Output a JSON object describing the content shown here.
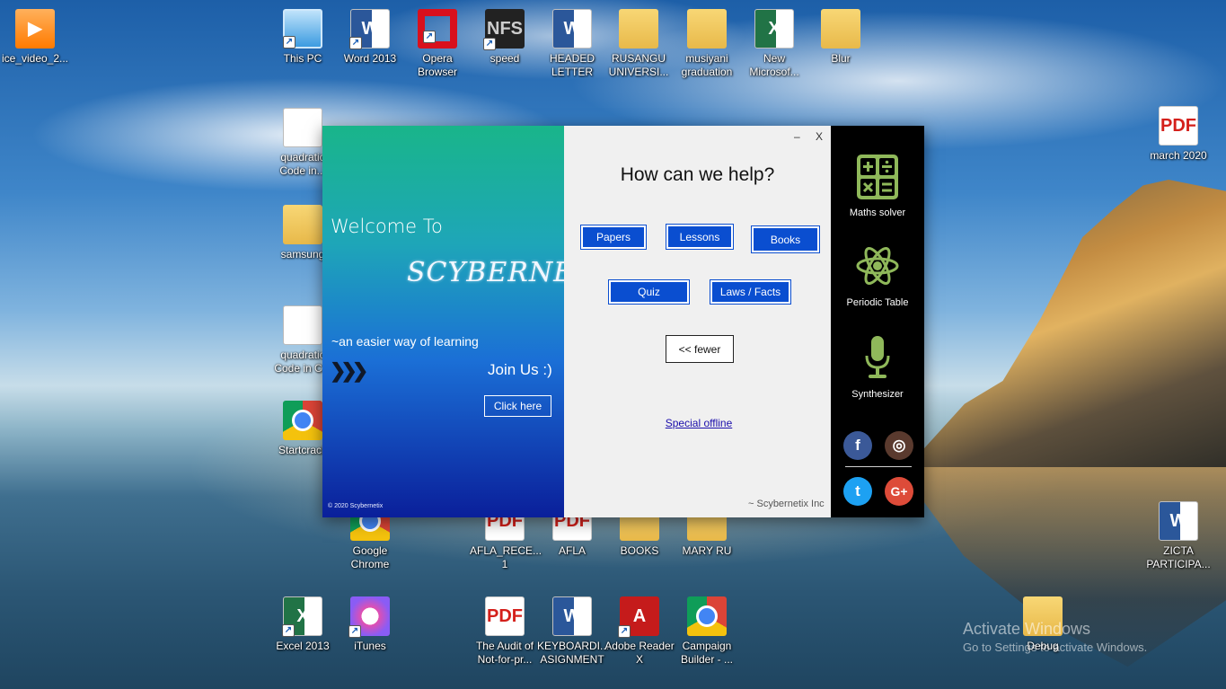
{
  "desktop": {
    "icons": [
      {
        "label": "ice_video_2...",
        "kind": "media"
      },
      {
        "label": "This PC",
        "kind": "pc"
      },
      {
        "label": "Word 2013",
        "kind": "word"
      },
      {
        "label": "Opera Browser",
        "kind": "opera"
      },
      {
        "label": "speed",
        "kind": "nfs"
      },
      {
        "label": "HEADED LETTER",
        "kind": "word"
      },
      {
        "label": "RUSANGU UNIVERSI...",
        "kind": "folder"
      },
      {
        "label": "musiyani graduation",
        "kind": "folder"
      },
      {
        "label": "New Microsof...",
        "kind": "excel"
      },
      {
        "label": "Blur",
        "kind": "folder"
      },
      {
        "label": "march 2020",
        "kind": "pdf"
      },
      {
        "label": "quadratic Code in...",
        "kind": "doc"
      },
      {
        "label": "samsung",
        "kind": "folder"
      },
      {
        "label": "quadratic Code in C...",
        "kind": "doc"
      },
      {
        "label": "Startcrack",
        "kind": "chrome"
      },
      {
        "label": "Google Chrome",
        "kind": "chrome"
      },
      {
        "label": "AFLA_RECE... 1",
        "kind": "pdf"
      },
      {
        "label": "AFLA",
        "kind": "pdf"
      },
      {
        "label": "BOOKS",
        "kind": "folder"
      },
      {
        "label": "MARY RU",
        "kind": "folder"
      },
      {
        "label": "ZICTA PARTICIPA...",
        "kind": "word"
      },
      {
        "label": "Excel 2013",
        "kind": "excel"
      },
      {
        "label": "iTunes",
        "kind": "itunes"
      },
      {
        "label": "The Audit of Not-for-pr...",
        "kind": "pdf"
      },
      {
        "label": "KEYBOARDI... ASIGNMENT",
        "kind": "word"
      },
      {
        "label": "Adobe Reader X",
        "kind": "adobe"
      },
      {
        "label": "Campaign Builder - ...",
        "kind": "chrome"
      },
      {
        "label": "Debug",
        "kind": "folder"
      }
    ],
    "watermark": {
      "title": "Activate Windows",
      "subtitle": "Go to Settings to activate Windows."
    }
  },
  "app": {
    "left": {
      "welcome": "Welcome To",
      "brand": "SCYBERNET",
      "tagline": "~an easier way of learning",
      "arrows": "❯❯❯",
      "join": "Join Us :)",
      "click_here": "Click here",
      "copyright": "© 2020 Scybernetix"
    },
    "center": {
      "minimize": "–",
      "close": "X",
      "title": "How can we help?",
      "buttons": {
        "papers": "Papers",
        "lessons": "Lessons",
        "books": "Books",
        "quiz": "Quiz",
        "laws": "Laws / Facts",
        "fewer": "<< fewer"
      },
      "special_offline": "Special offline",
      "company": "~ Scybernetix Inc"
    },
    "right": {
      "tools": [
        {
          "label": "Maths solver",
          "icon": "calculator-icon"
        },
        {
          "label": "Periodic Table",
          "icon": "atom-icon"
        },
        {
          "label": "Synthesizer",
          "icon": "microphone-icon"
        }
      ],
      "social": {
        "facebook": "f",
        "instagram": "◎",
        "twitter": "t",
        "google_plus": "G+"
      }
    }
  },
  "colors": {
    "accent_button": "#0a4ed0",
    "icon_green": "#8fb85a",
    "sidebar_bg": "#000000"
  }
}
